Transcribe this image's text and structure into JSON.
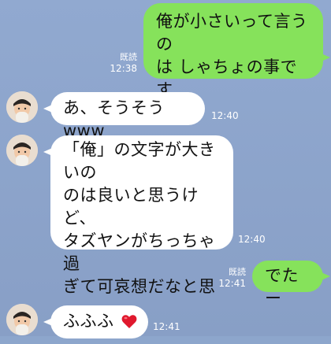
{
  "messages": [
    {
      "direction": "out",
      "text": "俺が小さいって言うの\nは しゃちょの事です\nか？",
      "read_label": "既読",
      "time": "12:38"
    },
    {
      "direction": "in",
      "text": "あ、そうそうwww",
      "time": "12:40"
    },
    {
      "direction": "in",
      "text": "「俺」の文字が大きいの\nのは良いと思うけど、\nタズヤンがちっちゃ過\nぎて可哀想だなと思っ\nてwww",
      "time": "12:40"
    },
    {
      "direction": "out",
      "text": "でたー",
      "read_label": "既読",
      "time": "12:41"
    },
    {
      "direction": "in",
      "text": "ふふふ",
      "emoji": "heart-emoji",
      "time": "12:41"
    }
  ],
  "colors": {
    "background": "#8da6cc",
    "outgoing_bubble": "#86e25b",
    "incoming_bubble": "#ffffff",
    "heart": "#e0182d"
  }
}
